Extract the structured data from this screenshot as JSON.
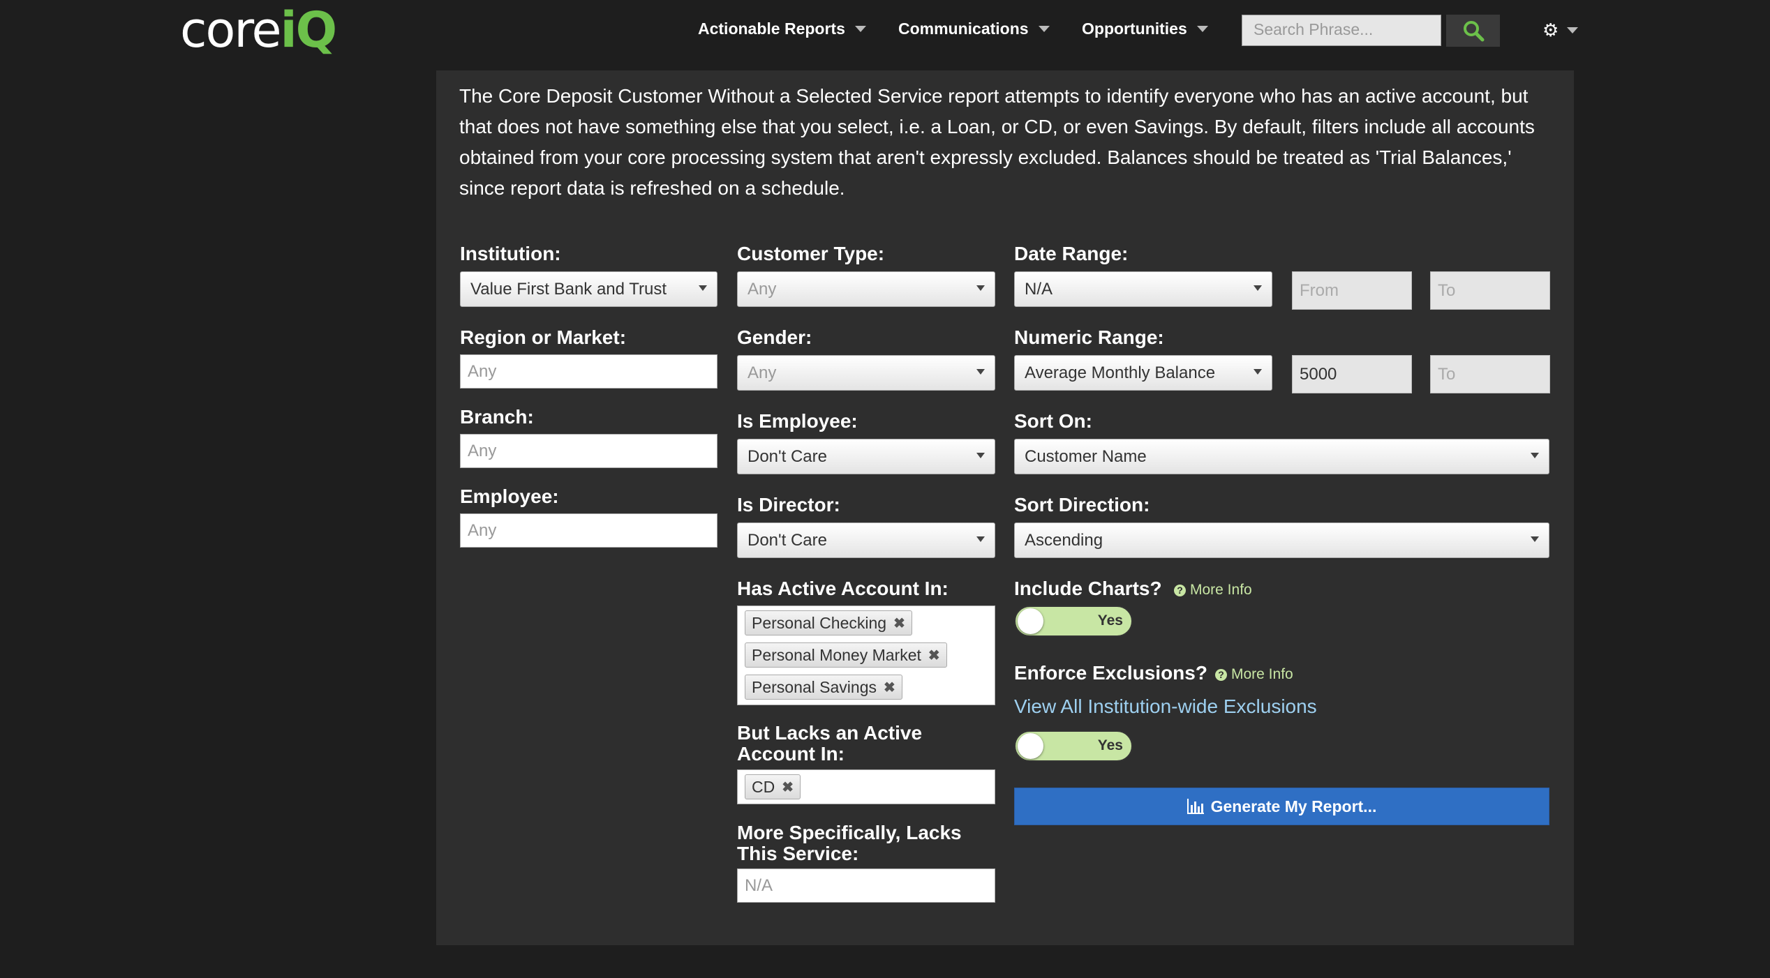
{
  "header": {
    "logo_core": "core",
    "logo_iq": "iQ",
    "nav": [
      "Actionable Reports",
      "Communications",
      "Opportunities"
    ],
    "search_placeholder": "Search Phrase..."
  },
  "description": "The Core Deposit Customer Without a Selected Service report attempts to identify everyone who has an active account, but that does not have something else that you select, i.e. a Loan, or CD, or even Savings. By default, filters include all accounts obtained from your core processing system that aren't expressly excluded. Balances should be treated as 'Trial Balances,' since report data is refreshed on a schedule.",
  "col1": {
    "institution_label": "Institution:",
    "institution_value": "Value First Bank and Trust",
    "region_label": "Region or Market:",
    "region_placeholder": "Any",
    "branch_label": "Branch:",
    "branch_placeholder": "Any",
    "employee_label": "Employee:",
    "employee_placeholder": "Any"
  },
  "col2": {
    "customer_type_label": "Customer Type:",
    "customer_type_value": "Any",
    "gender_label": "Gender:",
    "gender_value": "Any",
    "is_employee_label": "Is Employee:",
    "is_employee_value": "Don't Care",
    "is_director_label": "Is Director:",
    "is_director_value": "Don't Care",
    "has_active_label": "Has Active Account In:",
    "has_active_tags": [
      "Personal Checking",
      "Personal Money Market",
      "Personal Savings"
    ],
    "lacks_label_1": "But Lacks an Active",
    "lacks_label_2": "Account In:",
    "lacks_tags": [
      "CD"
    ],
    "specific_label_1": "More Specifically, Lacks",
    "specific_label_2": "This Service:",
    "specific_placeholder": "N/A"
  },
  "col3": {
    "date_range_label": "Date Range:",
    "date_range_value": "N/A",
    "date_from_placeholder": "From",
    "date_to_placeholder": "To",
    "numeric_range_label": "Numeric Range:",
    "numeric_range_value": "Average Monthly Balance",
    "numeric_from_value": "5000",
    "numeric_to_placeholder": "To",
    "sort_on_label": "Sort On:",
    "sort_on_value": "Customer Name",
    "sort_dir_label": "Sort Direction:",
    "sort_dir_value": "Ascending",
    "include_charts_label": "Include Charts?",
    "more_info": "More Info",
    "include_charts_toggle": "Yes",
    "enforce_label": "Enforce Exclusions?",
    "exclusions_link": "View All Institution-wide Exclusions",
    "enforce_toggle": "Yes",
    "generate_label": "Generate My Report..."
  },
  "colors": {
    "accent_green": "#6cc04a",
    "button_blue": "#2f6fc4",
    "toggle_on": "#c8e6a4",
    "link": "#9ed0f0"
  }
}
